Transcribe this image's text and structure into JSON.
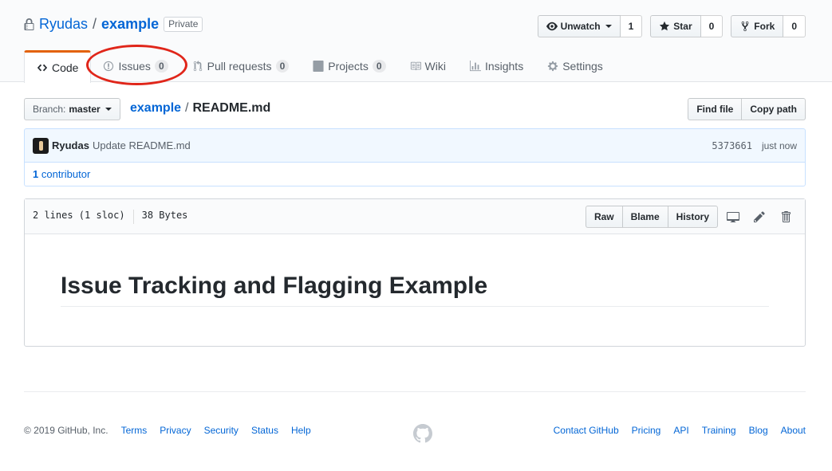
{
  "repo": {
    "owner": "Ryudas",
    "separator": "/",
    "name": "example",
    "visibility": "Private"
  },
  "actions": {
    "unwatch_label": "Unwatch",
    "unwatch_count": "1",
    "star_label": "Star",
    "star_count": "0",
    "fork_label": "Fork",
    "fork_count": "0"
  },
  "nav": {
    "code": "Code",
    "issues": "Issues",
    "issues_count": "0",
    "pull_requests": "Pull requests",
    "pull_requests_count": "0",
    "projects": "Projects",
    "projects_count": "0",
    "wiki": "Wiki",
    "insights": "Insights",
    "settings": "Settings"
  },
  "branch": {
    "prefix": "Branch:",
    "name": "master"
  },
  "breadcrumb": {
    "repo": "example",
    "separator": "/",
    "file": "README.md"
  },
  "file_actions": {
    "find_file": "Find file",
    "copy_path": "Copy path"
  },
  "commit": {
    "author": "Ryudas",
    "message": "Update README.md",
    "sha": "5373661",
    "time": "just now"
  },
  "contributors": {
    "count": "1",
    "label": "contributor"
  },
  "file": {
    "lines": "2 lines (1 sloc)",
    "size": "38 Bytes",
    "raw": "Raw",
    "blame": "Blame",
    "history": "History",
    "heading": "Issue Tracking and Flagging Example"
  },
  "footer": {
    "copyright": "© 2019 GitHub, Inc.",
    "left_links": [
      "Terms",
      "Privacy",
      "Security",
      "Status",
      "Help"
    ],
    "right_links": [
      "Contact GitHub",
      "Pricing",
      "API",
      "Training",
      "Blog",
      "About"
    ]
  },
  "colors": {
    "link": "#0366d6",
    "selected_tab_accent": "#e36209",
    "annotation_ring": "#e0261a",
    "commit_bg": "#f1f8ff"
  },
  "icons": [
    "lock-icon",
    "eye-icon",
    "star-icon",
    "fork-icon",
    "code-icon",
    "issue-icon",
    "pull-request-icon",
    "project-icon",
    "wiki-icon",
    "graph-icon",
    "gear-icon",
    "desktop-icon",
    "pencil-icon",
    "trash-icon",
    "github-mark-icon"
  ]
}
